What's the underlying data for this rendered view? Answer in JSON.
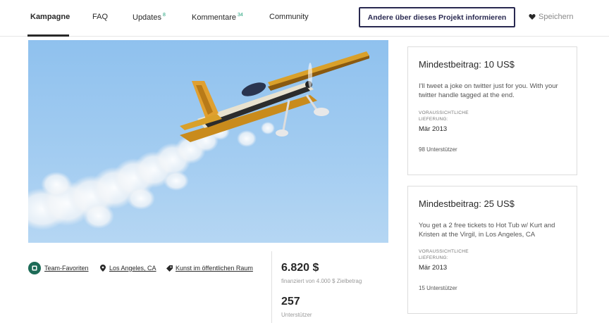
{
  "nav": {
    "tabs": [
      {
        "label": "Kampagne",
        "count": ""
      },
      {
        "label": "FAQ",
        "count": ""
      },
      {
        "label": "Updates",
        "count": "8"
      },
      {
        "label": "Kommentare",
        "count": "34"
      },
      {
        "label": "Community",
        "count": ""
      }
    ],
    "share_label": "Andere über dieses Projekt informieren",
    "save_label": "Speichern"
  },
  "project": {
    "category_badge": "Team-Favoriten",
    "location": "Los Angeles, CA",
    "category": "Kunst im öffentlichen Raum"
  },
  "stats": {
    "pledged": "6.820 $",
    "pledged_caption": "finanziert von 4.000 $ Zielbetrag",
    "backers": "257",
    "backers_caption": "Unterstützer"
  },
  "rewards": [
    {
      "title": "Mindestbeitrag: 10 US$",
      "description": "I'll tweet a joke on twitter just for you. With your twitter handle tagged at the end.",
      "delivery_label": "VORAUSSICHTLICHE LIEFERUNG:",
      "delivery": "Mär 2013",
      "backers": "98 Unterstützer"
    },
    {
      "title": "Mindestbeitrag: 25 US$",
      "description": "You get a 2 free tickets to Hot Tub w/ Kurt and Kristen at the Virgil, in Los Angeles, CA",
      "delivery_label": "VORAUSSICHTLICHE LIEFERUNG:",
      "delivery": "Mär 2013",
      "backers": "15 Unterstützer"
    }
  ]
}
